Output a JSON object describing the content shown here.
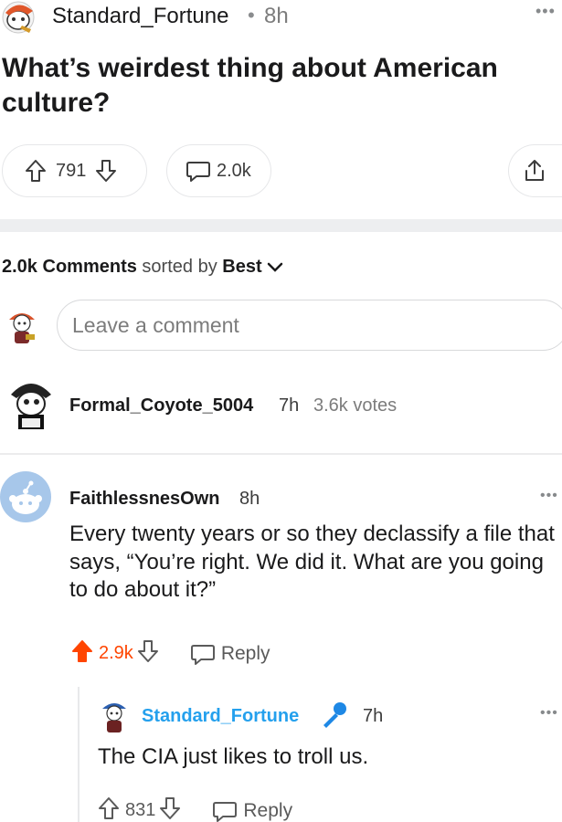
{
  "post": {
    "author": "Standard_Fortune",
    "separator": "•",
    "time": "8h",
    "more": "•••",
    "title": "What’s weirdest thing about American culture?",
    "upvotes": "791",
    "comments": "2.0k",
    "icons": [
      "upvote-icon",
      "downvote-icon",
      "comment-bubble-icon",
      "share-icon"
    ]
  },
  "comments_header": {
    "count": "2.0k",
    "label": "Comments",
    "sorted_by": "sorted by",
    "sort": "Best"
  },
  "composer": {
    "placeholder": "Leave a comment"
  },
  "collapsed_comment": {
    "author": "Formal_Coyote_5004",
    "time": "7h",
    "votes": "3.6k votes"
  },
  "comment": {
    "author": "FaithlessnesOwn",
    "time": "8h",
    "more": "•••",
    "body": "Every twenty years or so they declassify a file that says, “You’re right. We did it. What are you going to do about it?”",
    "score": "2.9k",
    "reply_label": "Reply",
    "upvoted_color": "#ff4500"
  },
  "reply": {
    "author": "Standard_Fortune",
    "author_color": "#24a0ed",
    "flair_icon": "microphone-icon",
    "time": "7h",
    "more": "•••",
    "body": "The CIA just likes to troll us.",
    "score": "831",
    "reply_label": "Reply"
  }
}
